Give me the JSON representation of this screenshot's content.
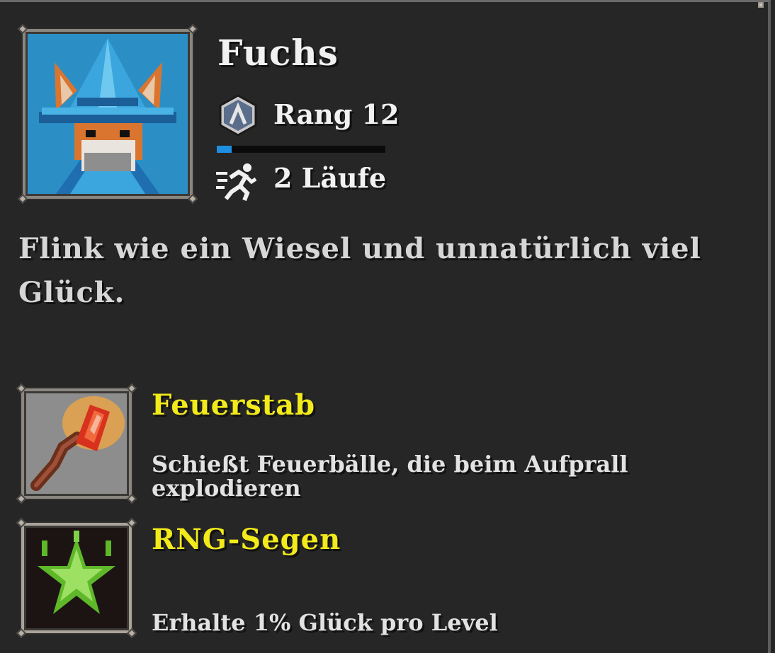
{
  "character": {
    "name": "Fuchs",
    "rank_label": "Rang 12",
    "rank_progress": 0.09,
    "runs_label": "2 Läufe",
    "description": "Flink wie ein Wiesel und unnatürlich viel Glück.",
    "portrait_icon": "fox-wizard-portrait"
  },
  "items": [
    {
      "title": "Feuerstab",
      "description": "Schießt Feuerbälle, die beim Aufprall explodieren",
      "icon": "fire-staff-icon"
    },
    {
      "title": "RNG-Segen",
      "description": "Erhalte 1% Glück pro Level",
      "icon": "green-star-icon"
    }
  ],
  "colors": {
    "background": "#262626",
    "title_yellow": "#f2ea1a",
    "progress_blue": "#1e8fe0",
    "text_white": "#f1f1f1"
  }
}
